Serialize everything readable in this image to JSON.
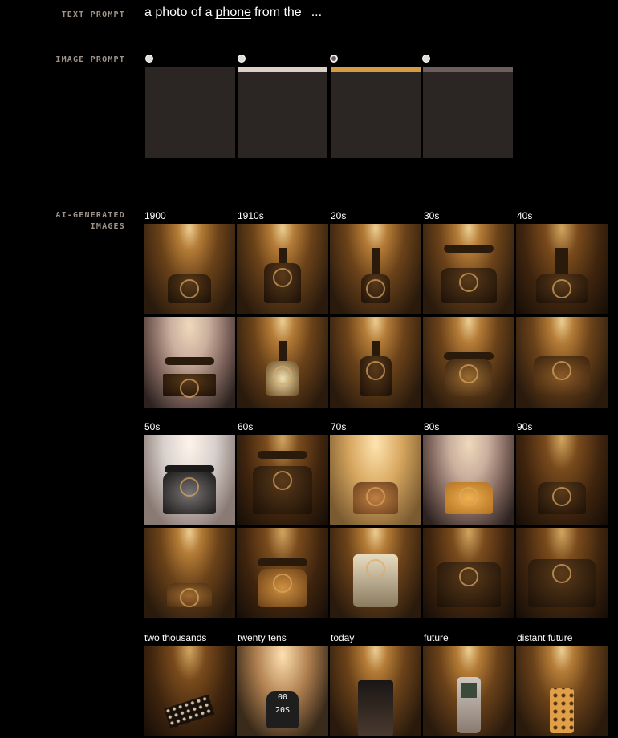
{
  "text_prompt": {
    "label": "TEXT PROMPT",
    "prefix": "a photo of a",
    "keyword": "phone",
    "suffix": "from the",
    "more": "..."
  },
  "image_prompt": {
    "label": "IMAGE PROMPT",
    "options": [
      {
        "selected": false,
        "icon": "radio-button-icon"
      },
      {
        "selected": false,
        "icon": "radio-button-icon"
      },
      {
        "selected": true,
        "icon": "radio-button-icon"
      },
      {
        "selected": false,
        "icon": "radio-button-icon"
      }
    ]
  },
  "generated": {
    "label_line1": "AI-GENERATED",
    "label_line2": "IMAGES",
    "decades": [
      "1900",
      "1910s",
      "20s",
      "30s",
      "40s",
      "50s",
      "60s",
      "70s",
      "80s",
      "90s",
      "two thousands",
      "twenty tens",
      "today",
      "future",
      "distant future"
    ],
    "display_text_line1": "00",
    "display_text_line2": "20S"
  },
  "colors": {
    "background": "#000000",
    "label": "#a0948a",
    "text": "#ffffff",
    "sepia": "#d79a45"
  }
}
